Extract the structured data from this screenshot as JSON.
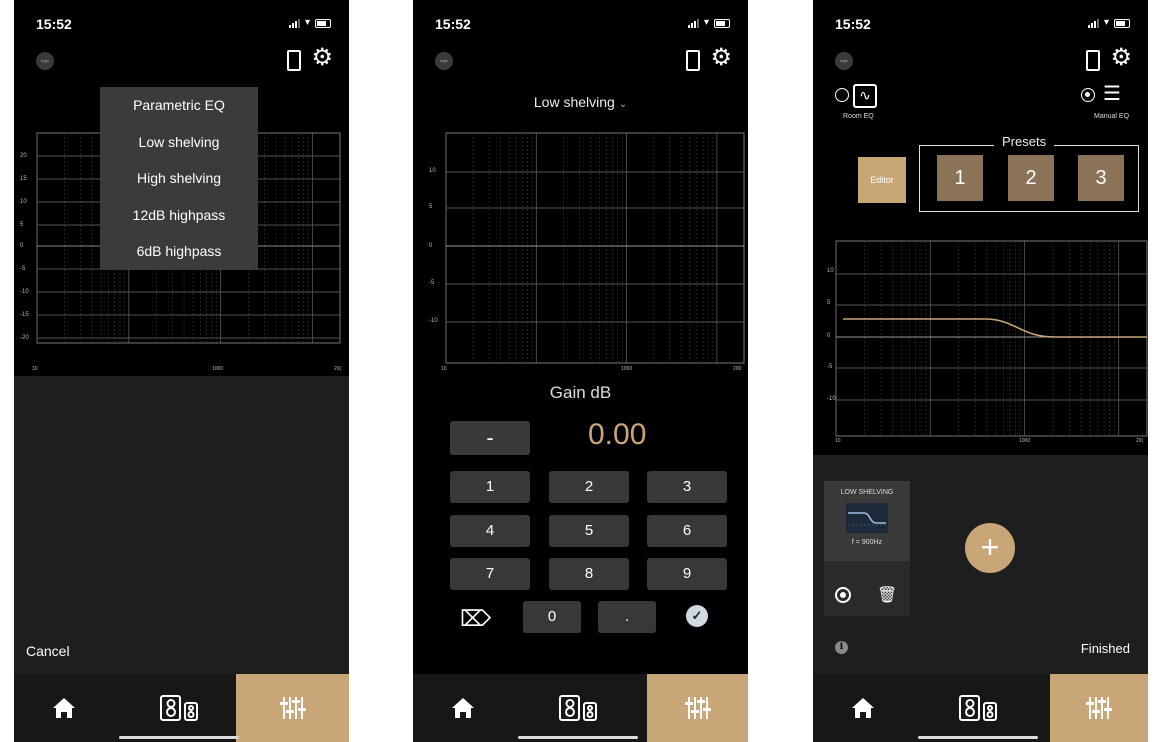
{
  "status": {
    "time": "15:52"
  },
  "phone1": {
    "menu": [
      "Parametric EQ",
      "Low shelving",
      "High shelving",
      "12dB highpass",
      "6dB highpass"
    ],
    "graph": {
      "y_ticks": [
        "20",
        "15",
        "10",
        "5",
        "0",
        "-5",
        "-10",
        "-15",
        "-20"
      ],
      "x_ticks": [
        "10",
        "1000",
        "20("
      ]
    },
    "cancel": "Cancel"
  },
  "phone2": {
    "filter_type": "Low shelving",
    "graph": {
      "y_ticks": [
        "10",
        "5",
        "0",
        "-5",
        "-10"
      ],
      "x_ticks": [
        "10",
        "1000",
        "200"
      ]
    },
    "gain_label": "Gain dB",
    "gain_value": "0.00",
    "minus": "-",
    "keys": [
      "1",
      "2",
      "3",
      "4",
      "5",
      "6",
      "7",
      "8",
      "9"
    ],
    "zero": "0",
    "dot": "."
  },
  "phone3": {
    "room_eq": "Room EQ",
    "manual_eq": "Manual EQ",
    "presets_title": "Presets",
    "editor": "Editor",
    "presets": [
      "1",
      "2",
      "3"
    ],
    "graph": {
      "y_ticks": [
        "10",
        "5",
        "0",
        "-5",
        "-10"
      ],
      "x_ticks": [
        "10",
        "1000",
        "20("
      ]
    },
    "filter_card": {
      "title": "LOW SHELVING",
      "freq": "f = 900Hz"
    },
    "add": "+",
    "finished": "Finished"
  },
  "colors": {
    "accent": "#c9a678",
    "preset": "#8a7356",
    "panel": "#1e1e1e"
  },
  "icons": [
    "home-icon",
    "speakers-icon",
    "mixer-icon",
    "gear-icon",
    "device-icon",
    "backspace-icon",
    "check-icon",
    "trash-icon",
    "record-icon",
    "info-icon",
    "room-eq-icon",
    "manual-eq-icon"
  ]
}
